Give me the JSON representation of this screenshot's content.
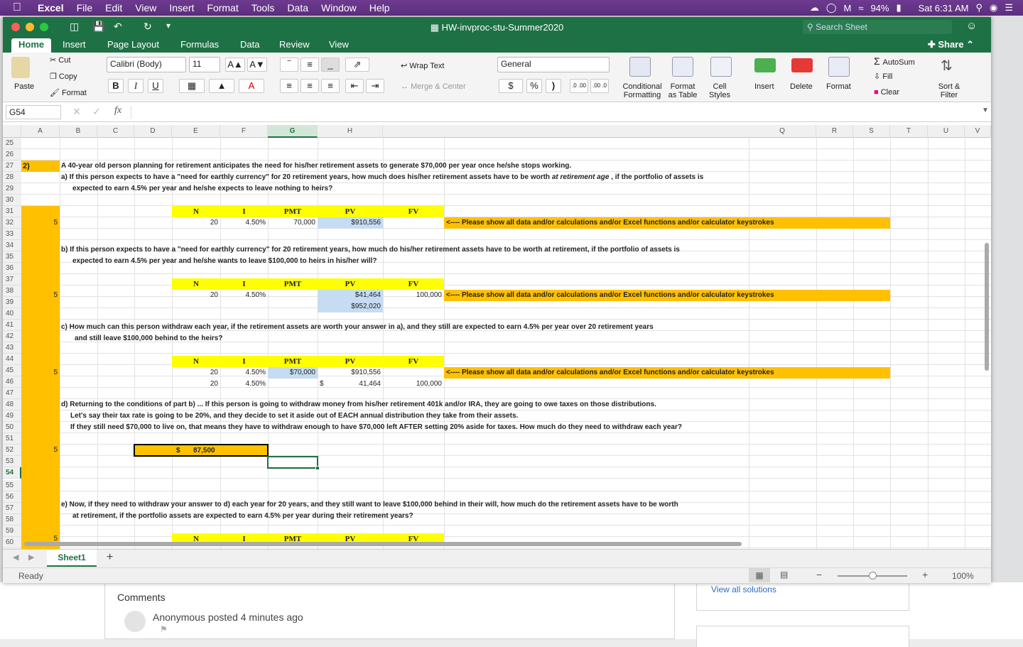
{
  "menubar": {
    "app": "Excel",
    "items": [
      "File",
      "Edit",
      "View",
      "Insert",
      "Format",
      "Tools",
      "Data",
      "Window",
      "Help"
    ],
    "battery": "94%",
    "clock": "Sat 6:31 AM"
  },
  "window": {
    "title": "HW-invproc-stu-Summer2020",
    "search_placeholder": "Search Sheet"
  },
  "ribbon": {
    "tabs": [
      "Home",
      "Insert",
      "Page Layout",
      "Formulas",
      "Data",
      "Review",
      "View"
    ],
    "share": "Share",
    "paste": "Paste",
    "cut": "Cut",
    "copy": "Copy",
    "format_painter": "Format",
    "font_name": "Calibri (Body)",
    "font_size": "11",
    "bold": "B",
    "italic": "I",
    "underline": "U",
    "wrap": "Wrap Text",
    "merge": "Merge & Center",
    "num_format": "General",
    "dollar": "$",
    "percent": "%",
    "comma": ")",
    "inc_dec": ".0 .00",
    "dec_dec": ".00 .0",
    "cond_fmt": "Conditional Formatting",
    "fmt_table": "Format as Table",
    "cell_styles": "Cell Styles",
    "insert": "Insert",
    "delete": "Delete",
    "format": "Format",
    "autosum": "AutoSum",
    "fill": "Fill",
    "clear": "Clear",
    "sort": "Sort & Filter"
  },
  "formula": {
    "namebox": "G54",
    "fx": "fx",
    "value": ""
  },
  "columns": [
    "A",
    "B",
    "C",
    "D",
    "E",
    "F",
    "G",
    "H",
    "Q",
    "R",
    "S",
    "T",
    "U",
    "V"
  ],
  "rows": [
    "25",
    "26",
    "27",
    "28",
    "29",
    "30",
    "31",
    "32",
    "33",
    "34",
    "35",
    "36",
    "37",
    "38",
    "39",
    "40",
    "41",
    "42",
    "43",
    "44",
    "45",
    "46",
    "47",
    "48",
    "49",
    "50",
    "51",
    "52",
    "53",
    "54",
    "55",
    "56",
    "57",
    "58",
    "59",
    "60",
    "61"
  ],
  "sheet": {
    "q_num": "2)",
    "intro": "A 40-year old person planning for retirement anticipates the need for his/her retirement assets to generate $70,000 per year once he/she stops working.",
    "a1": "a) If this person expects to have a \"need for earthly currency\" for 20 retirement years, how much does his/her retirement assets have to be worth ",
    "a1_em": "at retirement age",
    "a1_end": " , if the portfolio of assets is",
    "a2": "expected to earn 4.5% per year and he/she expects to leave nothing to heirs?",
    "hdr": {
      "n": "N",
      "i": "I",
      "pmt": "PMT",
      "pv": "PV",
      "fv": "FV"
    },
    "r32": {
      "pts": "5",
      "n": "20",
      "i": "4.50%",
      "pmt": "70,000",
      "pv": "$910,556"
    },
    "note": "<---- Please show all data and/or calculations and/or Excel functions and/or calculator keystrokes",
    "b1": "b) If this person expects to have a \"need for earthly currency\" for 20 retirement years, how much do his/her retirement assets have to be worth at retirement, if the portfolio of assets is",
    "b2": "expected to earn 4.5% per year and he/she wants to leave $100,000 to heirs in his/her will?",
    "r39": {
      "pts": "5",
      "n": "20",
      "i": "4.50%",
      "pv": "$41,464",
      "fv": "100,000"
    },
    "r40": {
      "pv": "$952,020"
    },
    "c1": "c) How much can this person withdraw each year, if the retirement assets are worth your answer in a), and they still are expected to earn 4.5% per year over 20 retirement years",
    "c2": "and still leave $100,000 behind to the heirs?",
    "r46": {
      "pts": "5",
      "n": "20",
      "i": "4.50%",
      "pmt": "$70,000",
      "pv": "$910,556"
    },
    "r47": {
      "n": "20",
      "i": "4.50%",
      "dollar": "$",
      "pv": "41,464",
      "fv": "100,000"
    },
    "d1": "d) Returning to the conditions of part b) ...  If this person is going to withdraw money from his/her retirement 401k and/or IRA, they are going to owe taxes on those distributions.",
    "d2": "Let's say their tax rate is going to be 20%, and they decide to set it aside out of EACH annual distribution they take from their assets.",
    "d3": "If they still need $70,000 to live on, that means they have to withdraw enough to have $70,000 left AFTER setting 20% aside for taxes.  How much do they need to withdraw each year?",
    "r53": {
      "pts": "5",
      "dollar": "$",
      "val": "87,500"
    },
    "e1": "e) Now, if they need to withdraw your answer to d) each year for 20 years, and they still want to leave $100,000 behind in their will, how much do the retirement assets have to be worth",
    "e2": "at retirement, if the portfolio assets are expected to earn 4.5% per year during their retirement years?",
    "r59": {
      "pts": "5"
    }
  },
  "tabs": {
    "sheet1": "Sheet1",
    "add": "+"
  },
  "status": {
    "ready": "Ready",
    "zoom": "100%"
  },
  "page": {
    "comments": "Comments",
    "anon": "Anonymous posted 4 minutes ago",
    "view_solutions": "View all solutions"
  }
}
